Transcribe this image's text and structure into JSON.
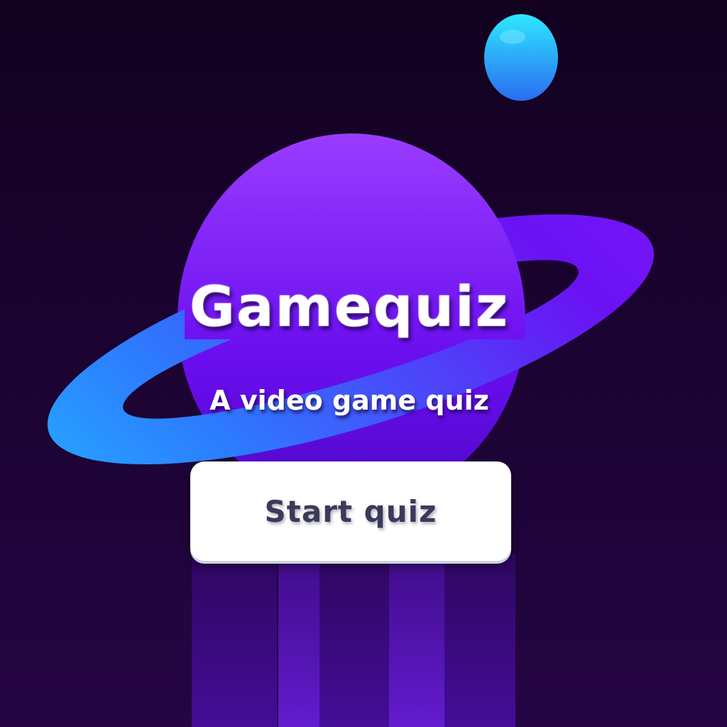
{
  "title": "Gamequiz",
  "subtitle": "A video game quiz",
  "start_button": {
    "label": "Start quiz"
  },
  "colors": {
    "background_top": "#12011f",
    "background_bottom": "#250544",
    "planet": "#7b12f4",
    "ring": "#1fd2ff",
    "moon": "#22c8f5",
    "button": "#ffffff",
    "button_text": "#3b3a5a"
  }
}
